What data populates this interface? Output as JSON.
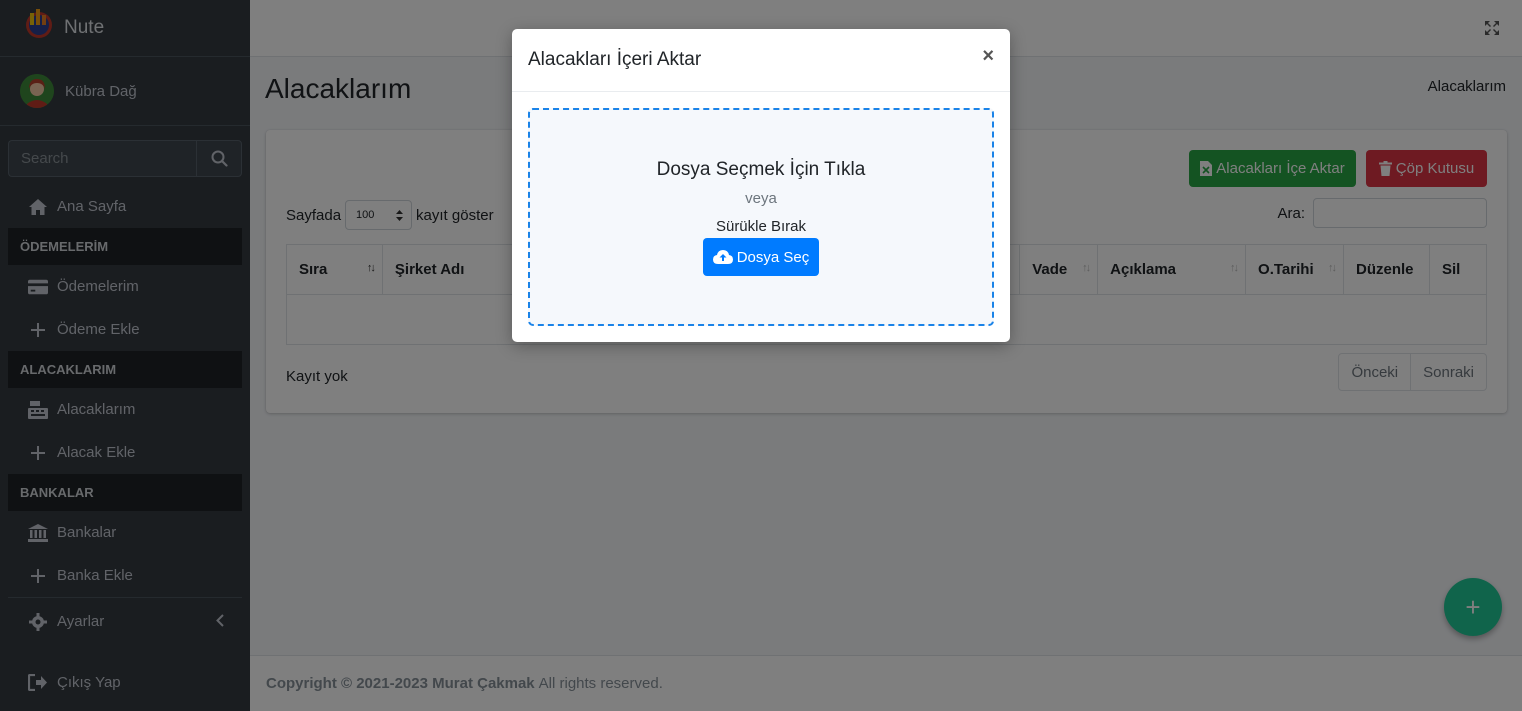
{
  "brand": {
    "name": "Nute"
  },
  "user": {
    "name": "Kübra Dağ"
  },
  "sidebar": {
    "search_placeholder": "Search",
    "items": [
      {
        "type": "item",
        "label": "Ana Sayfa",
        "icon": "home-icon"
      },
      {
        "type": "header",
        "label": "ÖDEMELERİM"
      },
      {
        "type": "item",
        "label": "Ödemelerim",
        "icon": "credit-card-icon"
      },
      {
        "type": "item",
        "label": "Ödeme Ekle",
        "icon": "plus-icon"
      },
      {
        "type": "header",
        "label": "ALACAKLARIM"
      },
      {
        "type": "item",
        "label": "Alacaklarım",
        "icon": "cash-register-icon"
      },
      {
        "type": "item",
        "label": "Alacak Ekle",
        "icon": "plus-icon"
      },
      {
        "type": "header",
        "label": "BANKALAR"
      },
      {
        "type": "item",
        "label": "Bankalar",
        "icon": "bank-icon"
      },
      {
        "type": "item",
        "label": "Banka Ekle",
        "icon": "plus-icon"
      },
      {
        "type": "item",
        "label": "Ayarlar",
        "icon": "gear-icon"
      },
      {
        "type": "item",
        "label": "Çıkış Yap",
        "icon": "sign-out-icon"
      }
    ]
  },
  "page": {
    "title": "Alacaklarım",
    "breadcrumb": "Alacaklarım"
  },
  "toolbar": {
    "import_label": "Alacakları İçe Aktar",
    "trash_label": "Çöp Kutusu"
  },
  "table": {
    "length_prefix": "Sayfada",
    "length_value": "100",
    "length_suffix": "kayıt göster",
    "search_label": "Ara:",
    "columns": [
      "Sıra",
      "Şirket Adı",
      "",
      "",
      "",
      "Vade",
      "Açıklama",
      "O.Tarihi",
      "Düzenle",
      "Sil"
    ],
    "info": "Kayıt yok",
    "prev_label": "Önceki",
    "next_label": "Sonraki"
  },
  "footer": {
    "copyright": "Copyright © 2021-2023 Murat Çakmak",
    "rights": "All rights reserved."
  },
  "fab": {
    "label": "+"
  },
  "modal": {
    "title": "Alacakları İçeri Aktar",
    "close_label": "×",
    "dropzone_main": "Dosya Seçmek İçin Tıkla",
    "dropzone_or": "veya",
    "dropzone_drag": "Sürükle Bırak",
    "choose_button": "Dosya Seç"
  },
  "colors": {
    "sidebar_bg": "#343a40",
    "primary": "#007bff",
    "success": "#28a745",
    "danger": "#dc3545",
    "fab": "#20c997"
  }
}
